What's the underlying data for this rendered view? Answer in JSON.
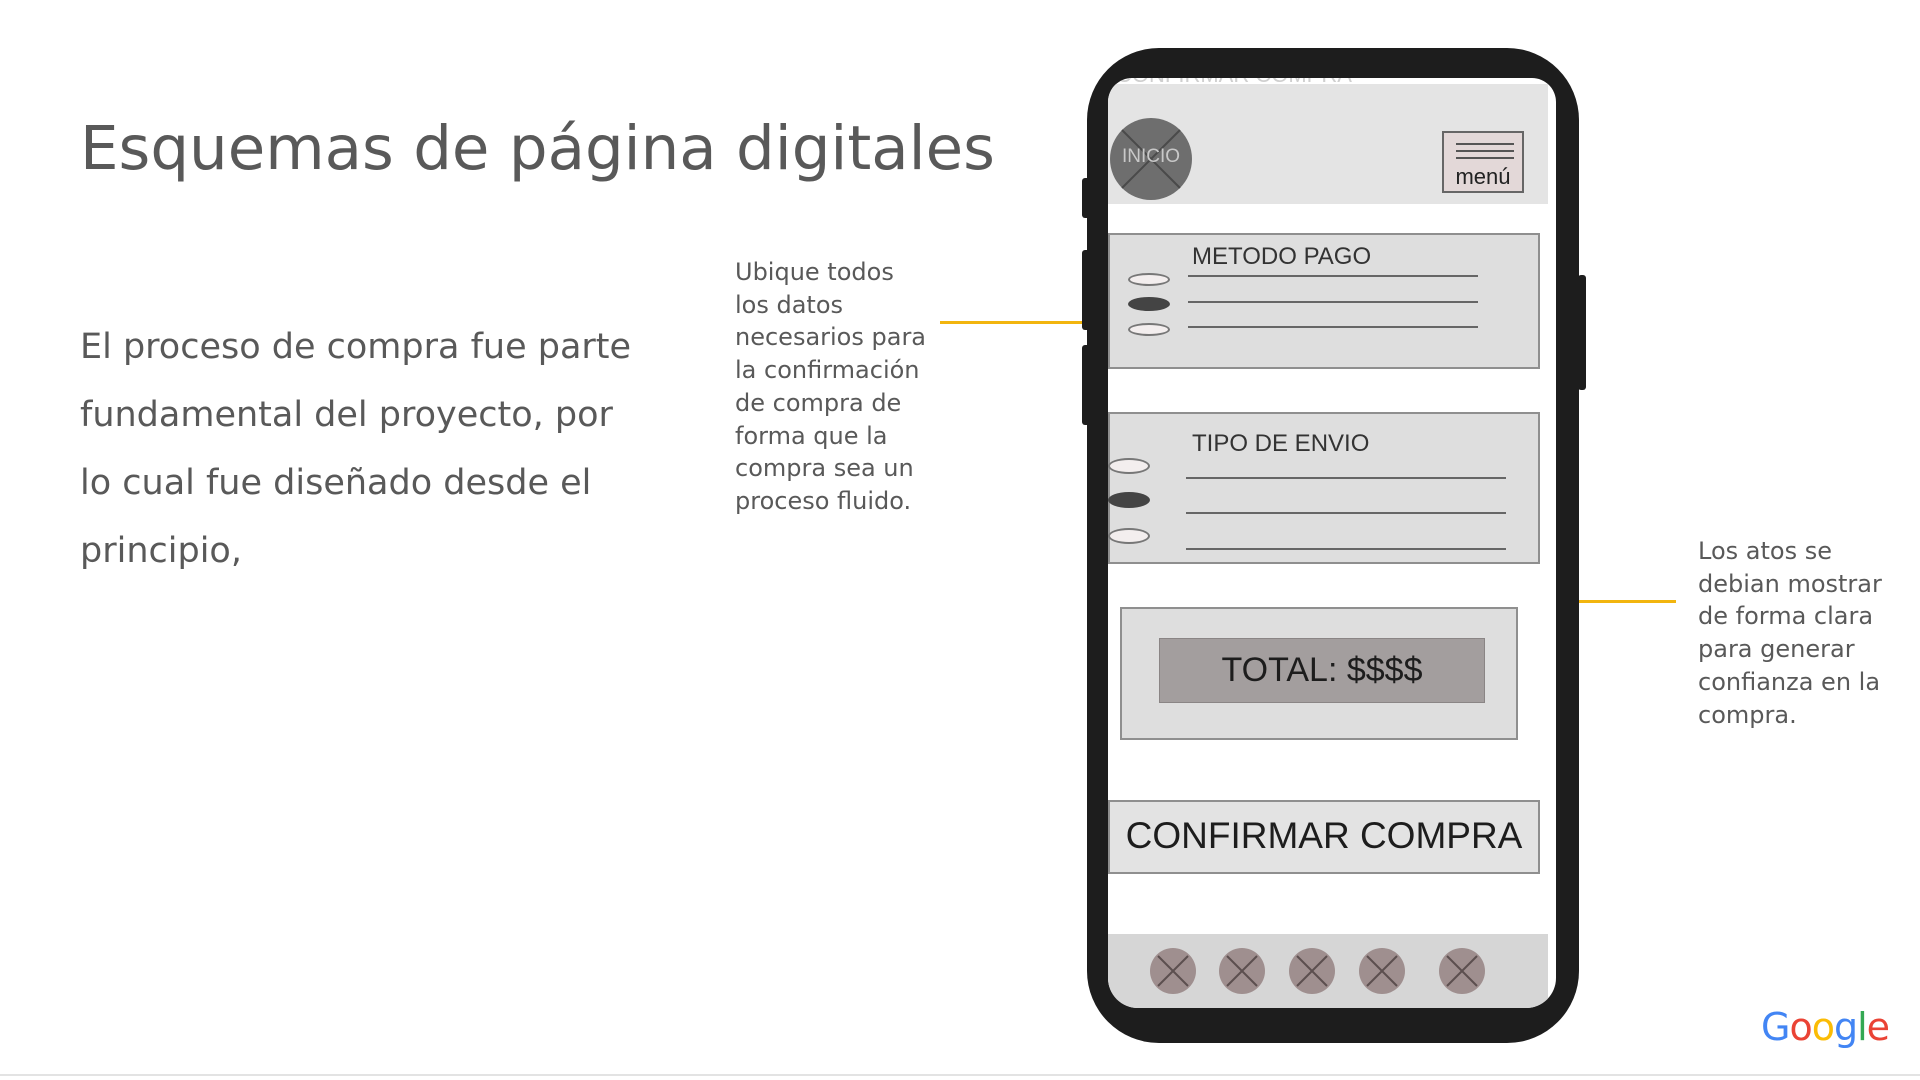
{
  "slide": {
    "title": "Esquemas de página digitales",
    "body": "El proceso de compra fue parte fundamental del proyecto, por lo cual fue diseñado desde el principio,",
    "note_left": "Ubique todos los datos necesarios para la confirmación de compra de forma que la compra sea un proceso fluido.",
    "note_right": "Los atos se debian mostrar de forma clara para generar confianza en la compra.",
    "callout_color": "#f2b50f",
    "logo": {
      "text": "Google",
      "icon": "google-logo"
    }
  },
  "phone": {
    "ghost_title": "CONFIRMAR COMPRA",
    "header": {
      "inicio_label": "INICIO",
      "menu_label": "menú"
    },
    "metodo_pago": {
      "title": "METODO PAGO",
      "options_count": 3,
      "selected_index": 1
    },
    "tipo_envio": {
      "title": "TIPO DE ENVIO",
      "options_count": 3,
      "selected_index": 1
    },
    "total_label": "TOTAL: $$$$",
    "confirm_label": "CONFIRMAR COMPRA",
    "bottom_nav": [
      "placeholder-icon",
      "placeholder-icon",
      "placeholder-icon",
      "placeholder-icon",
      "placeholder-icon"
    ]
  }
}
